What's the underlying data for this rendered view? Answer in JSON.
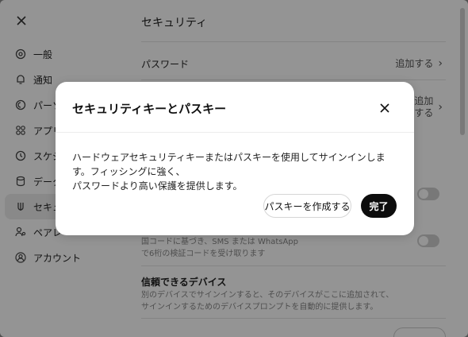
{
  "settings": {
    "sidebar": {
      "items": [
        {
          "label": "一般",
          "icon": "gear-icon"
        },
        {
          "label": "通知",
          "icon": "bell-icon"
        },
        {
          "label": "パーソナ",
          "icon": "personalization-icon"
        },
        {
          "label": "アプリ",
          "icon": "apps-grid-icon"
        },
        {
          "label": "スケジ",
          "icon": "clock-icon"
        },
        {
          "label": "データ",
          "icon": "database-icon"
        },
        {
          "label": "セキュリ",
          "icon": "security-icon",
          "active": true
        },
        {
          "label": "ペアレ",
          "icon": "parental-icon"
        },
        {
          "label": "アカウント",
          "icon": "account-icon"
        }
      ]
    },
    "main": {
      "title": "セキュリティ",
      "password_label": "パスワード",
      "password_action": "追加する",
      "passkey_action_line1": "追加",
      "passkey_action_line2": "する",
      "sms_desc_line1": "国コードに基づき、SMS または WhatsApp",
      "sms_desc_line2": "で6桁の検証コードを受け取ります",
      "trusted_title": "信頼できるデバイス",
      "trusted_desc_line1": "別のデバイスでサインインすると、そのデバイスがここに追加されて、",
      "trusted_desc_line2": "サインインするためのデバイスプロンプトを自動的に提供します。"
    }
  },
  "dialog": {
    "title": "セキュリティキーとパスキー",
    "body_line1": "ハードウェアセキュリティキーまたはパスキーを使用してサインインします。フィッシングに強く、",
    "body_line2": "パスワードより高い保護を提供します。",
    "create_passkey_label": "パスキーを作成する",
    "done_label": "完了"
  }
}
